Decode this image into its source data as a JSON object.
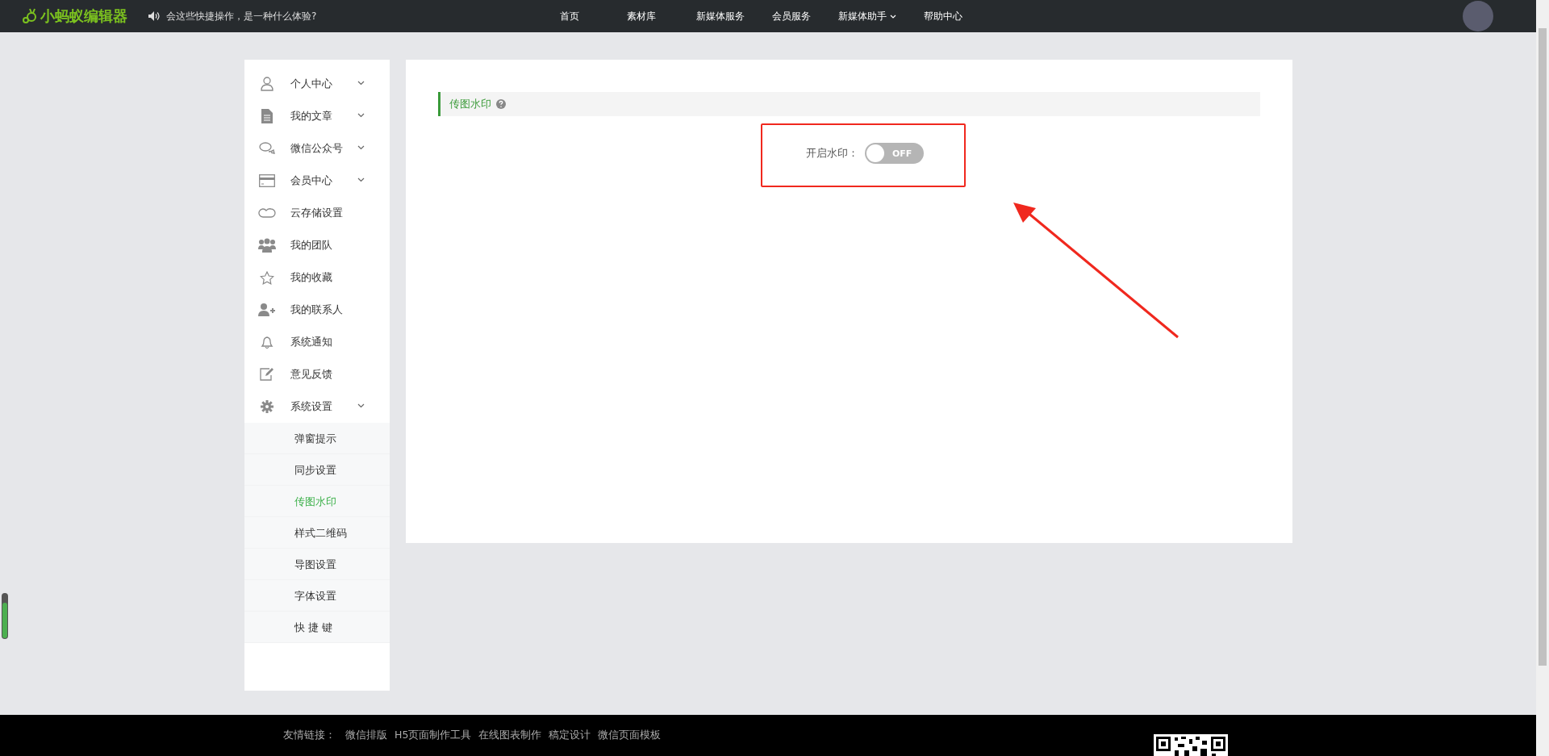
{
  "topbar": {
    "logo": "小蚂蚁编辑器",
    "notice": "会这些快捷操作，是一种什么体验?",
    "nav": [
      {
        "label": "首页",
        "dropdown": false
      },
      {
        "label": "素材库",
        "dropdown": false
      },
      {
        "label": "新媒体服务",
        "dropdown": false
      },
      {
        "label": "会员服务",
        "dropdown": false
      },
      {
        "label": "新媒体助手",
        "dropdown": true
      },
      {
        "label": "帮助中心",
        "dropdown": false
      }
    ]
  },
  "sidebar": {
    "items": [
      {
        "label": "个人中心",
        "expandable": true
      },
      {
        "label": "我的文章",
        "expandable": true
      },
      {
        "label": "微信公众号",
        "expandable": true
      },
      {
        "label": "会员中心",
        "expandable": true
      },
      {
        "label": "云存储设置",
        "expandable": false
      },
      {
        "label": "我的团队",
        "expandable": false
      },
      {
        "label": "我的收藏",
        "expandable": false
      },
      {
        "label": "我的联系人",
        "expandable": false
      },
      {
        "label": "系统通知",
        "expandable": false
      },
      {
        "label": "意见反馈",
        "expandable": false
      },
      {
        "label": "系统设置",
        "expandable": true,
        "children": [
          {
            "label": "弹窗提示",
            "selected": false
          },
          {
            "label": "同步设置",
            "selected": false
          },
          {
            "label": "传图水印",
            "selected": true
          },
          {
            "label": "样式二维码",
            "selected": false
          },
          {
            "label": "导图设置",
            "selected": false
          },
          {
            "label": "字体设置",
            "selected": false
          },
          {
            "label": "快 捷 键",
            "selected": false
          }
        ]
      }
    ]
  },
  "panel": {
    "title": "传图水印",
    "toggle_label": "开启水印：",
    "toggle": {
      "on": false,
      "text": "OFF"
    }
  },
  "footer": {
    "label": "友情链接：",
    "links": [
      "微信排版",
      "H5页面制作工具",
      "在线图表制作",
      "稿定设计",
      "微信页面模板"
    ]
  }
}
